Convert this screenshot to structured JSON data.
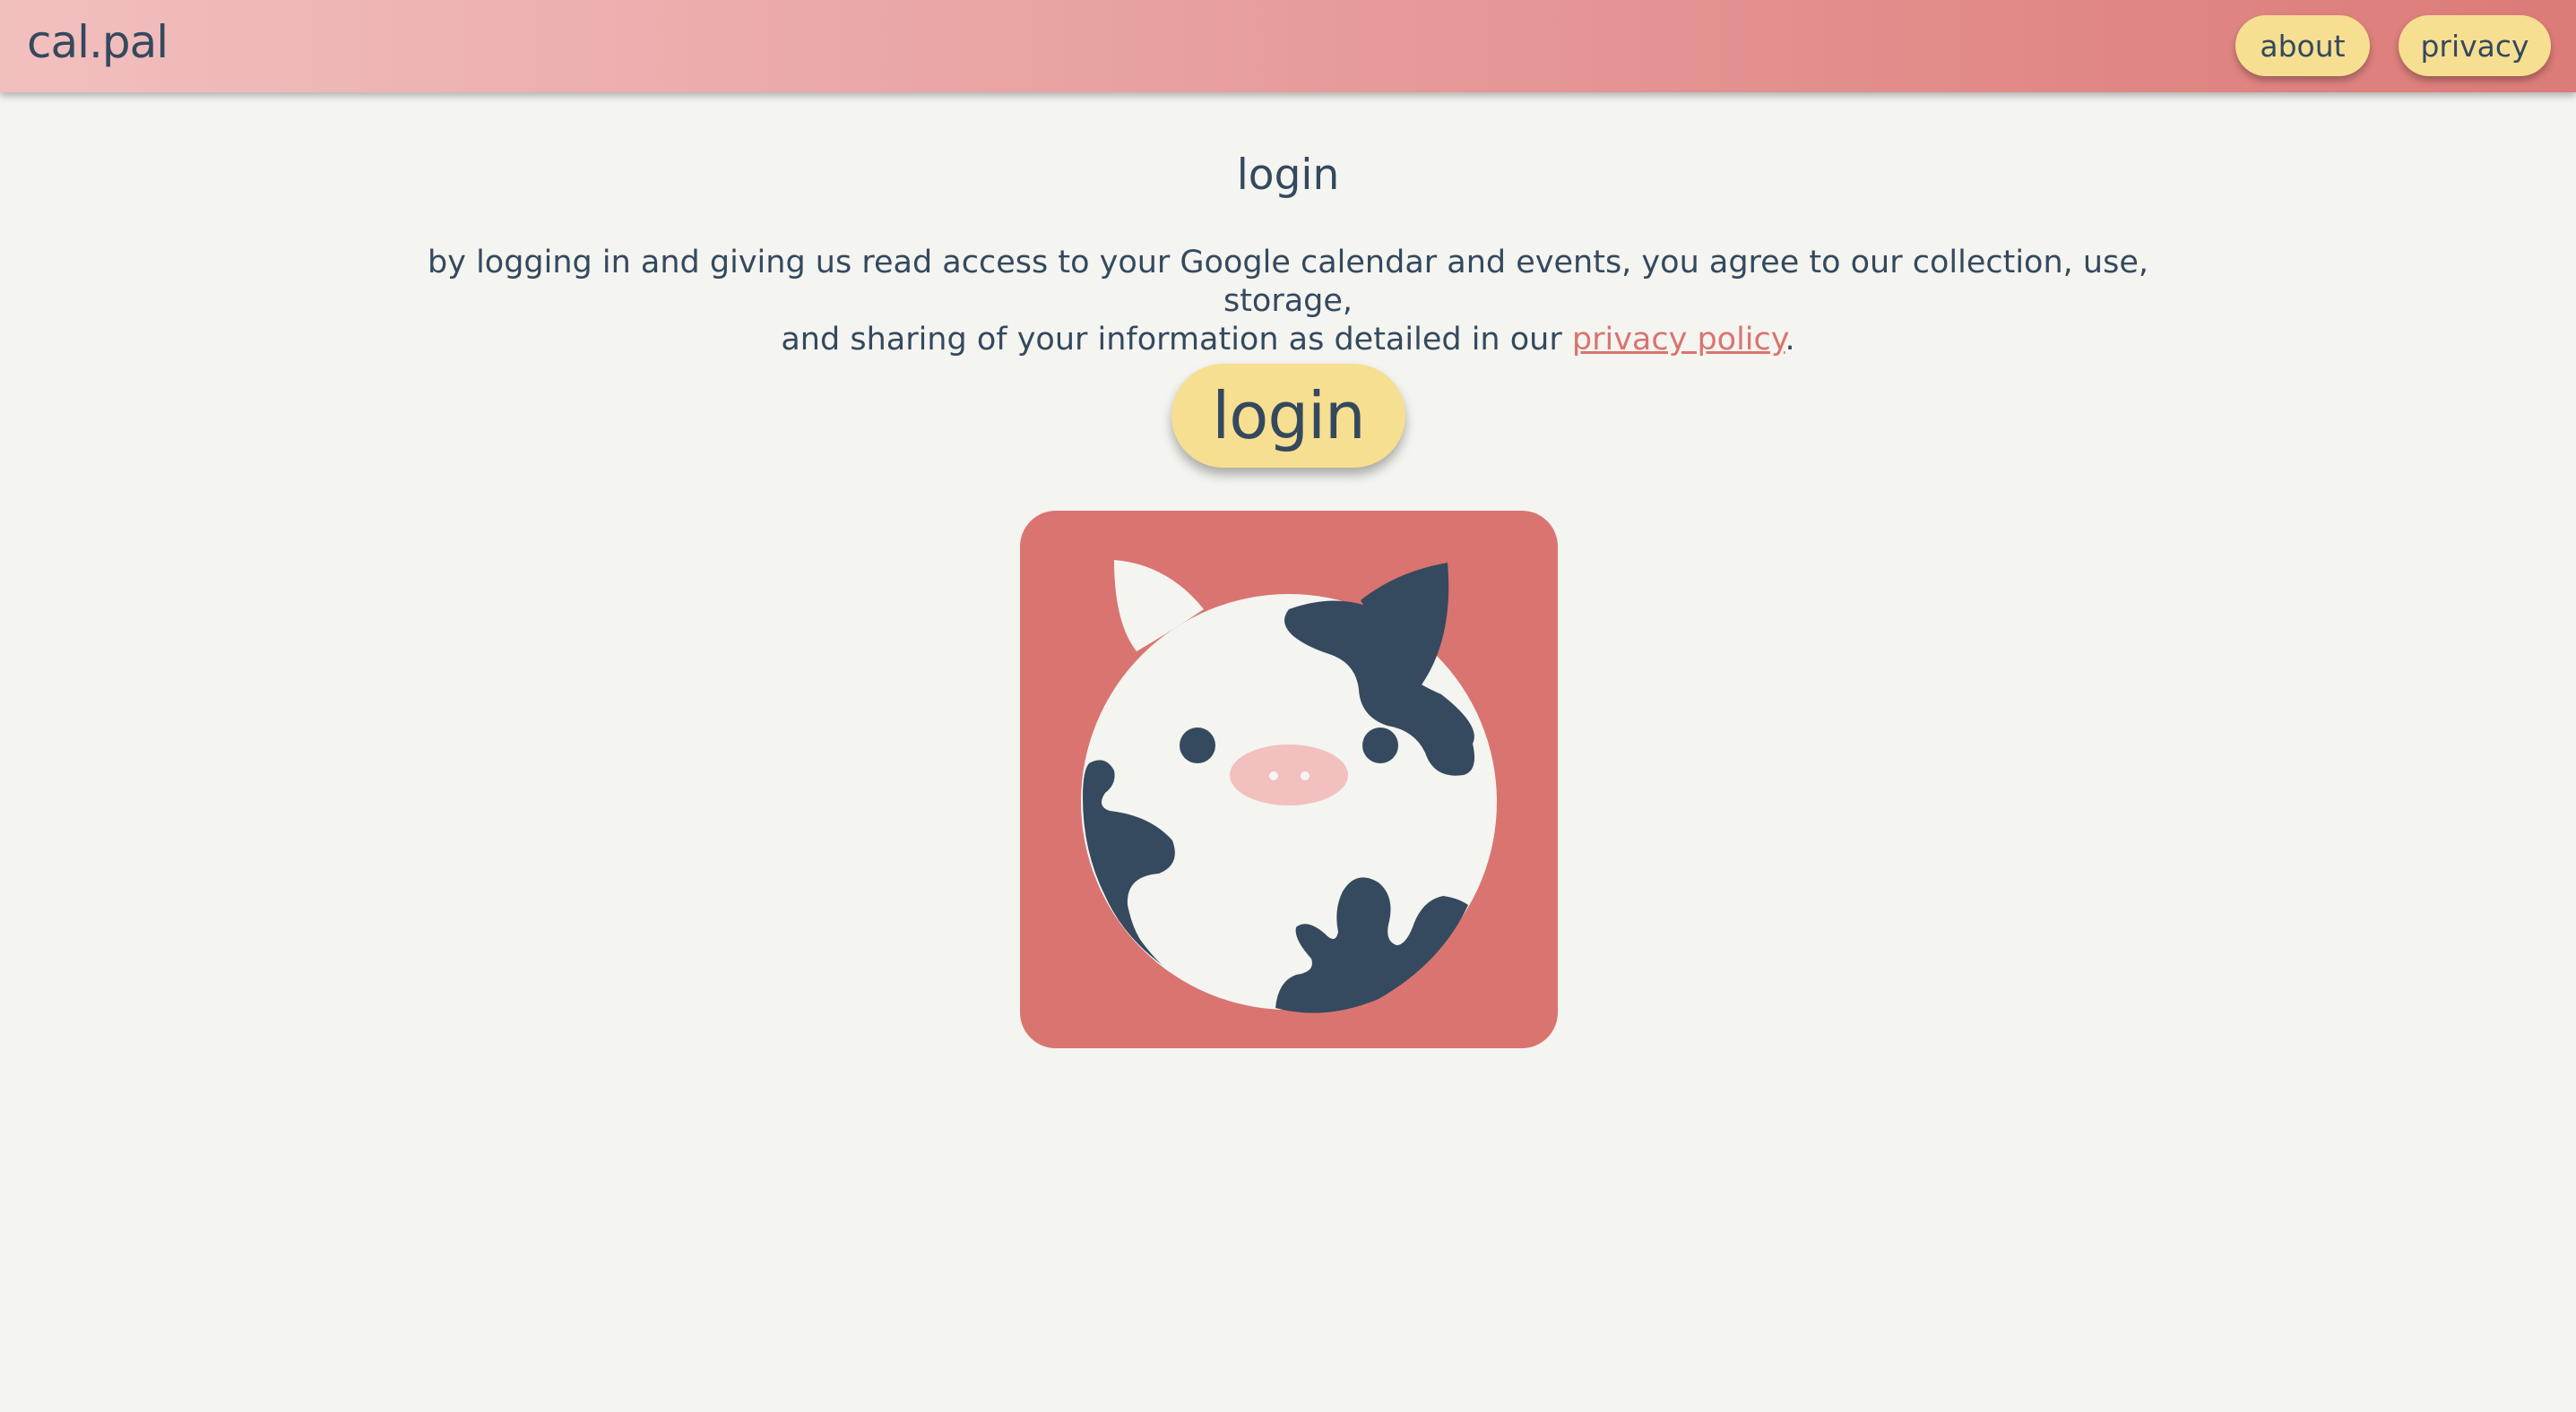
{
  "header": {
    "brand": "cal.pal",
    "nav": {
      "about_label": "about",
      "privacy_label": "privacy"
    }
  },
  "main": {
    "title": "login",
    "consent": {
      "line1": "by logging in and giving us read access to your Google calendar and events, you agree to our collection, use, storage,",
      "line2_prefix": "and sharing of your information as detailed in our",
      "link_text": "privacy policy",
      "line2_suffix": "."
    },
    "login_label": "login"
  },
  "logo": {
    "icon": "cow-mascot-icon"
  },
  "colors": {
    "header_gradient_start": "#f2bfbf",
    "header_gradient_end": "#dc7b78",
    "button_yellow": "#f6df91",
    "text_navy": "#34495e",
    "link_red": "#d9746f",
    "logo_bg": "#da7470",
    "page_bg": "#f4f4f0"
  }
}
